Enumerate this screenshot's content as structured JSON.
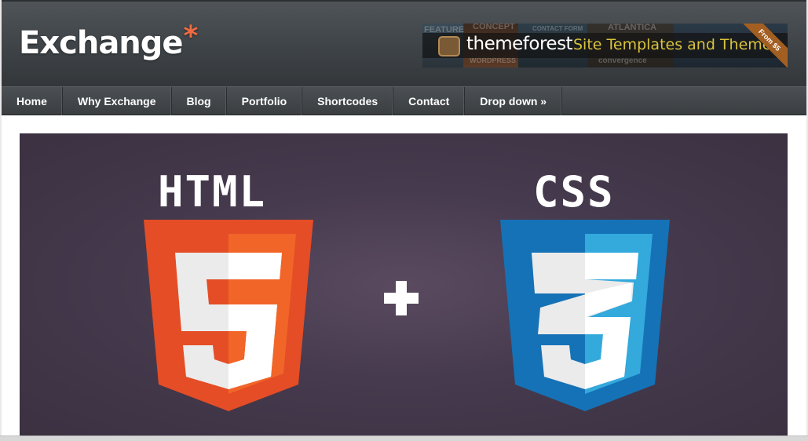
{
  "site": {
    "logo_text": "Exchange",
    "logo_asterisk": "*"
  },
  "banner": {
    "brand": "themeforest",
    "tagline": "Site Templates and Themes",
    "ribbon": "From $5",
    "background_words": [
      "FEATURE",
      "CONCEPT",
      "WORDPRESS",
      "CONTACT FORM",
      "ATLANTICA",
      "convergence"
    ]
  },
  "nav": {
    "items": [
      "Home",
      "Why Exchange",
      "Blog",
      "Portfolio",
      "Shortcodes",
      "Contact",
      "Drop down »"
    ]
  },
  "hero": {
    "left_word": "HTML",
    "right_word": "CSS",
    "plus": "+",
    "html_colors": {
      "dark": "#e44d26",
      "light": "#f16529"
    },
    "css_colors": {
      "dark": "#1572b6",
      "light": "#33a9dc"
    }
  }
}
